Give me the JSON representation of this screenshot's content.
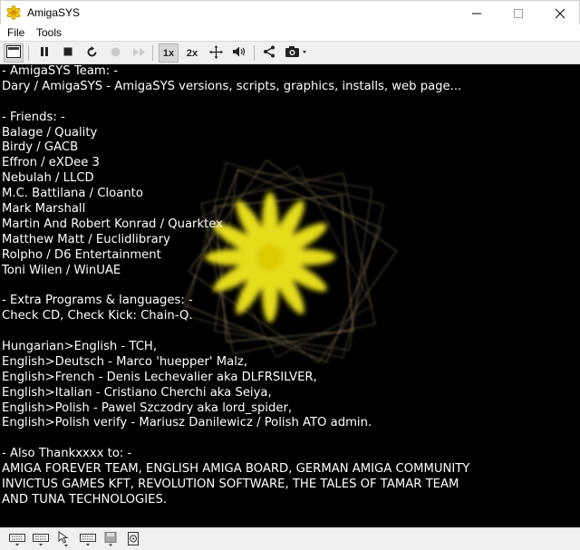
{
  "window": {
    "title": "AmigaSYS"
  },
  "menu": {
    "items": [
      "File",
      "Tools"
    ]
  },
  "toolbar": {
    "zoom_1x": "1x",
    "zoom_2x": "2x"
  },
  "credits": [
    "- AmigaSYS Team: -",
    "Dary / AmigaSYS - AmigaSYS versions, scripts, graphics, installs, web page...",
    "",
    "- Friends: -",
    "Balage / Quality",
    "Birdy / GACB",
    "Effron / eXDee 3",
    "Nebulah / LLCD",
    "M.C. Battilana / Cloanto",
    "Mark Marshall",
    "Martin And Robert Konrad / Quarktex",
    "Matthew Matt / Euclidlibrary",
    "Rolpho / D6 Entertainment",
    "Toni Wilen / WinUAE",
    "",
    "- Extra Programs & languages: -",
    "Check CD, Check Kick: Chain-Q.",
    "",
    "Hungarian>English - TCH,",
    "English>Deutsch - Marco 'huepper' Malz,",
    "English>French - Denis Lechevalier aka DLFRSILVER,",
    "English>Italian - Cristiano Cherchi aka Seiya,",
    "English>Polish - Pawel Szczodry aka lord_spider,",
    "English>Polish verify - Mariusz Danilewicz / Polish ATO admin.",
    "",
    "- Also Thankxxxx to: -",
    "AMIGA FOREVER TEAM, ENGLISH AMIGA BOARD, GERMAN AMIGA COMMUNITY",
    "INVICTUS GAMES KFT, REVOLUTION SOFTWARE, THE TALES OF TAMAR TEAM",
    "AND TUNA TECHNOLOGIES."
  ],
  "icons": {
    "app": "flower-icon",
    "toolbar": [
      "display-icon",
      "pause-icon",
      "stop-icon",
      "reset-icon",
      "record-icon",
      "fast-forward-icon",
      "move-icon",
      "volume-icon",
      "share-icon",
      "camera-icon"
    ],
    "status": [
      "keyboard-icon",
      "mouse-icon",
      "keyboard-icon",
      "floppy-drive-icon",
      "hard-drive-icon"
    ]
  },
  "colors": {
    "screen_bg": "#000000",
    "text": "#ffffff",
    "flower": "#f2e81c"
  }
}
